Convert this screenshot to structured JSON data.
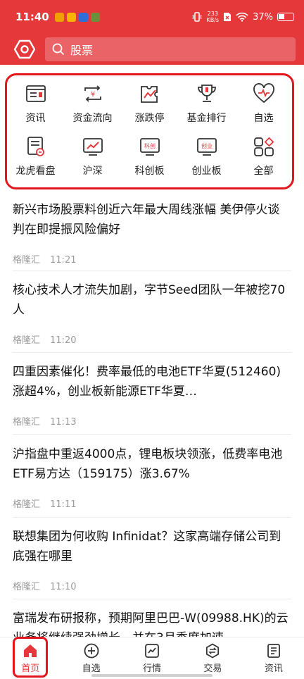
{
  "status_bar": {
    "time": "11:40",
    "net_speed_top": "233",
    "net_speed_bottom": "KB/s",
    "battery": "37%"
  },
  "header": {
    "search_placeholder": "股票",
    "accent_color": "#e5383b"
  },
  "quick_links": [
    {
      "label": "资讯",
      "icon": "news-icon"
    },
    {
      "label": "资金流向",
      "icon": "money-flow-icon"
    },
    {
      "label": "涨跌停",
      "icon": "limit-chart-icon"
    },
    {
      "label": "基金排行",
      "icon": "trophy-icon"
    },
    {
      "label": "自选",
      "icon": "heart-icon"
    },
    {
      "label": "龙虎看盘",
      "icon": "dragon-tiger-icon"
    },
    {
      "label": "沪深",
      "icon": "trend-chart-icon"
    },
    {
      "label": "科创板",
      "icon": "star-market-icon"
    },
    {
      "label": "创业板",
      "icon": "growth-board-icon"
    },
    {
      "label": "全部",
      "icon": "grid-all-icon"
    }
  ],
  "quick_badges": {
    "star_market": "科创",
    "growth_board": "创业"
  },
  "news": [
    {
      "title": "新兴市场股票料创近六年最大周线涨幅 美伊停火谈判在即提振风险偏好",
      "source": "格隆汇",
      "time": "11:21"
    },
    {
      "title": "核心技术人才流失加剧，字节Seed团队一年被挖70人",
      "source": "格隆汇",
      "time": "11:20"
    },
    {
      "title": "四重因素催化！费率最低的电池ETF华夏(512460)涨超4%，创业板新能源ETF华夏…",
      "source": "格隆汇",
      "time": "11:13"
    },
    {
      "title": "沪指盘中重返4000点，锂电板块领涨，低费率电池ETF易方达（159175）涨3.67%",
      "source": "格隆汇",
      "time": "11:11"
    },
    {
      "title": "联想集团为何收购 Infinidat？这家高端存储公司到底强在哪里",
      "source": "格隆汇",
      "time": "11:10"
    },
    {
      "title": "富瑞发布研报称，预期阿里巴巴-W(09988.HK)的云业务将继续强劲增长，并在3月季度加速",
      "source": "",
      "time": ""
    }
  ],
  "bottom_nav": [
    {
      "label": "首页",
      "icon": "home-icon",
      "active": true
    },
    {
      "label": "自选",
      "icon": "plus-circle-icon",
      "active": false
    },
    {
      "label": "行情",
      "icon": "market-chart-icon",
      "active": false
    },
    {
      "label": "交易",
      "icon": "trade-icon",
      "active": false
    },
    {
      "label": "资讯",
      "icon": "article-icon",
      "active": false
    }
  ]
}
